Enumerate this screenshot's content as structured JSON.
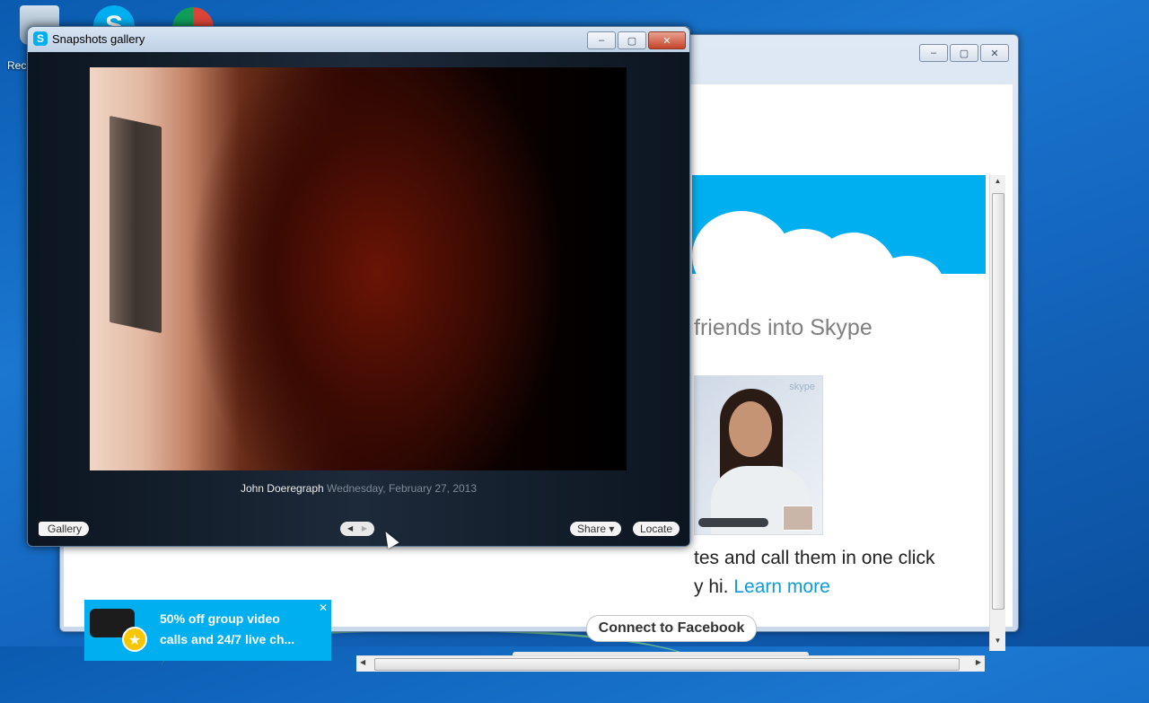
{
  "desktop": {
    "recycle_bin_label": "Rec"
  },
  "background_window": {
    "headline": "friends into Skype",
    "photo_watermark": "skype",
    "body_line1": "tes and call them in one click",
    "body_line2_prefix": "y hi.",
    "learn_more": "Learn more",
    "connect_button": "Connect to Facebook",
    "promo_text_line1": "50% off group video",
    "promo_text_line2": "calls and 24/7 live ch...",
    "controls": {
      "minimize": "–",
      "maximize": "▢",
      "close": "✕"
    }
  },
  "gallery": {
    "title": "Snapshots gallery",
    "caption_name": "John Doeregraph",
    "caption_date": "Wednesday, February 27, 2013",
    "gallery_button": "Gallery",
    "share_button": "Share ▾",
    "locate_button": "Locate",
    "prev_glyph": "◀",
    "next_glyph": "▶",
    "controls": {
      "minimize": "–",
      "maximize": "▢",
      "close": "✕"
    }
  },
  "colors": {
    "skype_blue": "#00aff0",
    "link": "#0d9bd9"
  }
}
